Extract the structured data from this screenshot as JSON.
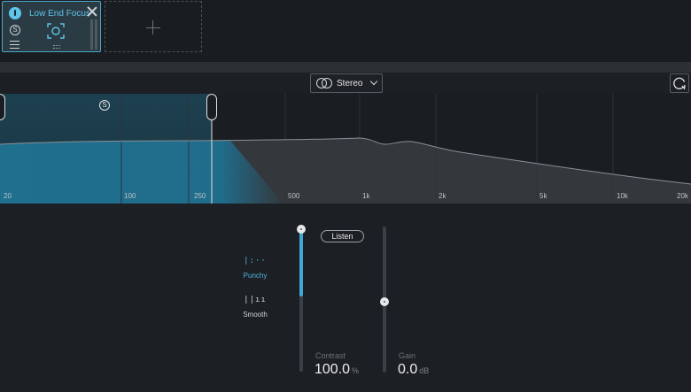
{
  "module": {
    "title": "Low End Focus",
    "solo_glyph": "S",
    "power_icon": "power-icon",
    "close_icon": "close-icon",
    "add_icon": "plus-icon"
  },
  "header": {
    "channel_mode": "Stereo",
    "channel_icon": "stereo-rings-icon",
    "reset_icon": "reset-icon"
  },
  "spectrum": {
    "band_solo_glyph": "S",
    "freq_labels": [
      "20",
      "100",
      "250",
      "500",
      "1k",
      "2k",
      "5k",
      "10k",
      "20k"
    ],
    "accent": "#3fa9d6"
  },
  "controls": {
    "modes": [
      {
        "glyph": "|:··",
        "label": "Punchy",
        "selected": true
      },
      {
        "glyph": "||ıı",
        "label": "Smooth",
        "selected": false
      }
    ],
    "listen_label": "Listen",
    "contrast": {
      "label": "Contrast",
      "value": "100.0",
      "unit": "%"
    },
    "gain": {
      "label": "Gain",
      "value": "0.0",
      "unit": "dB"
    }
  }
}
